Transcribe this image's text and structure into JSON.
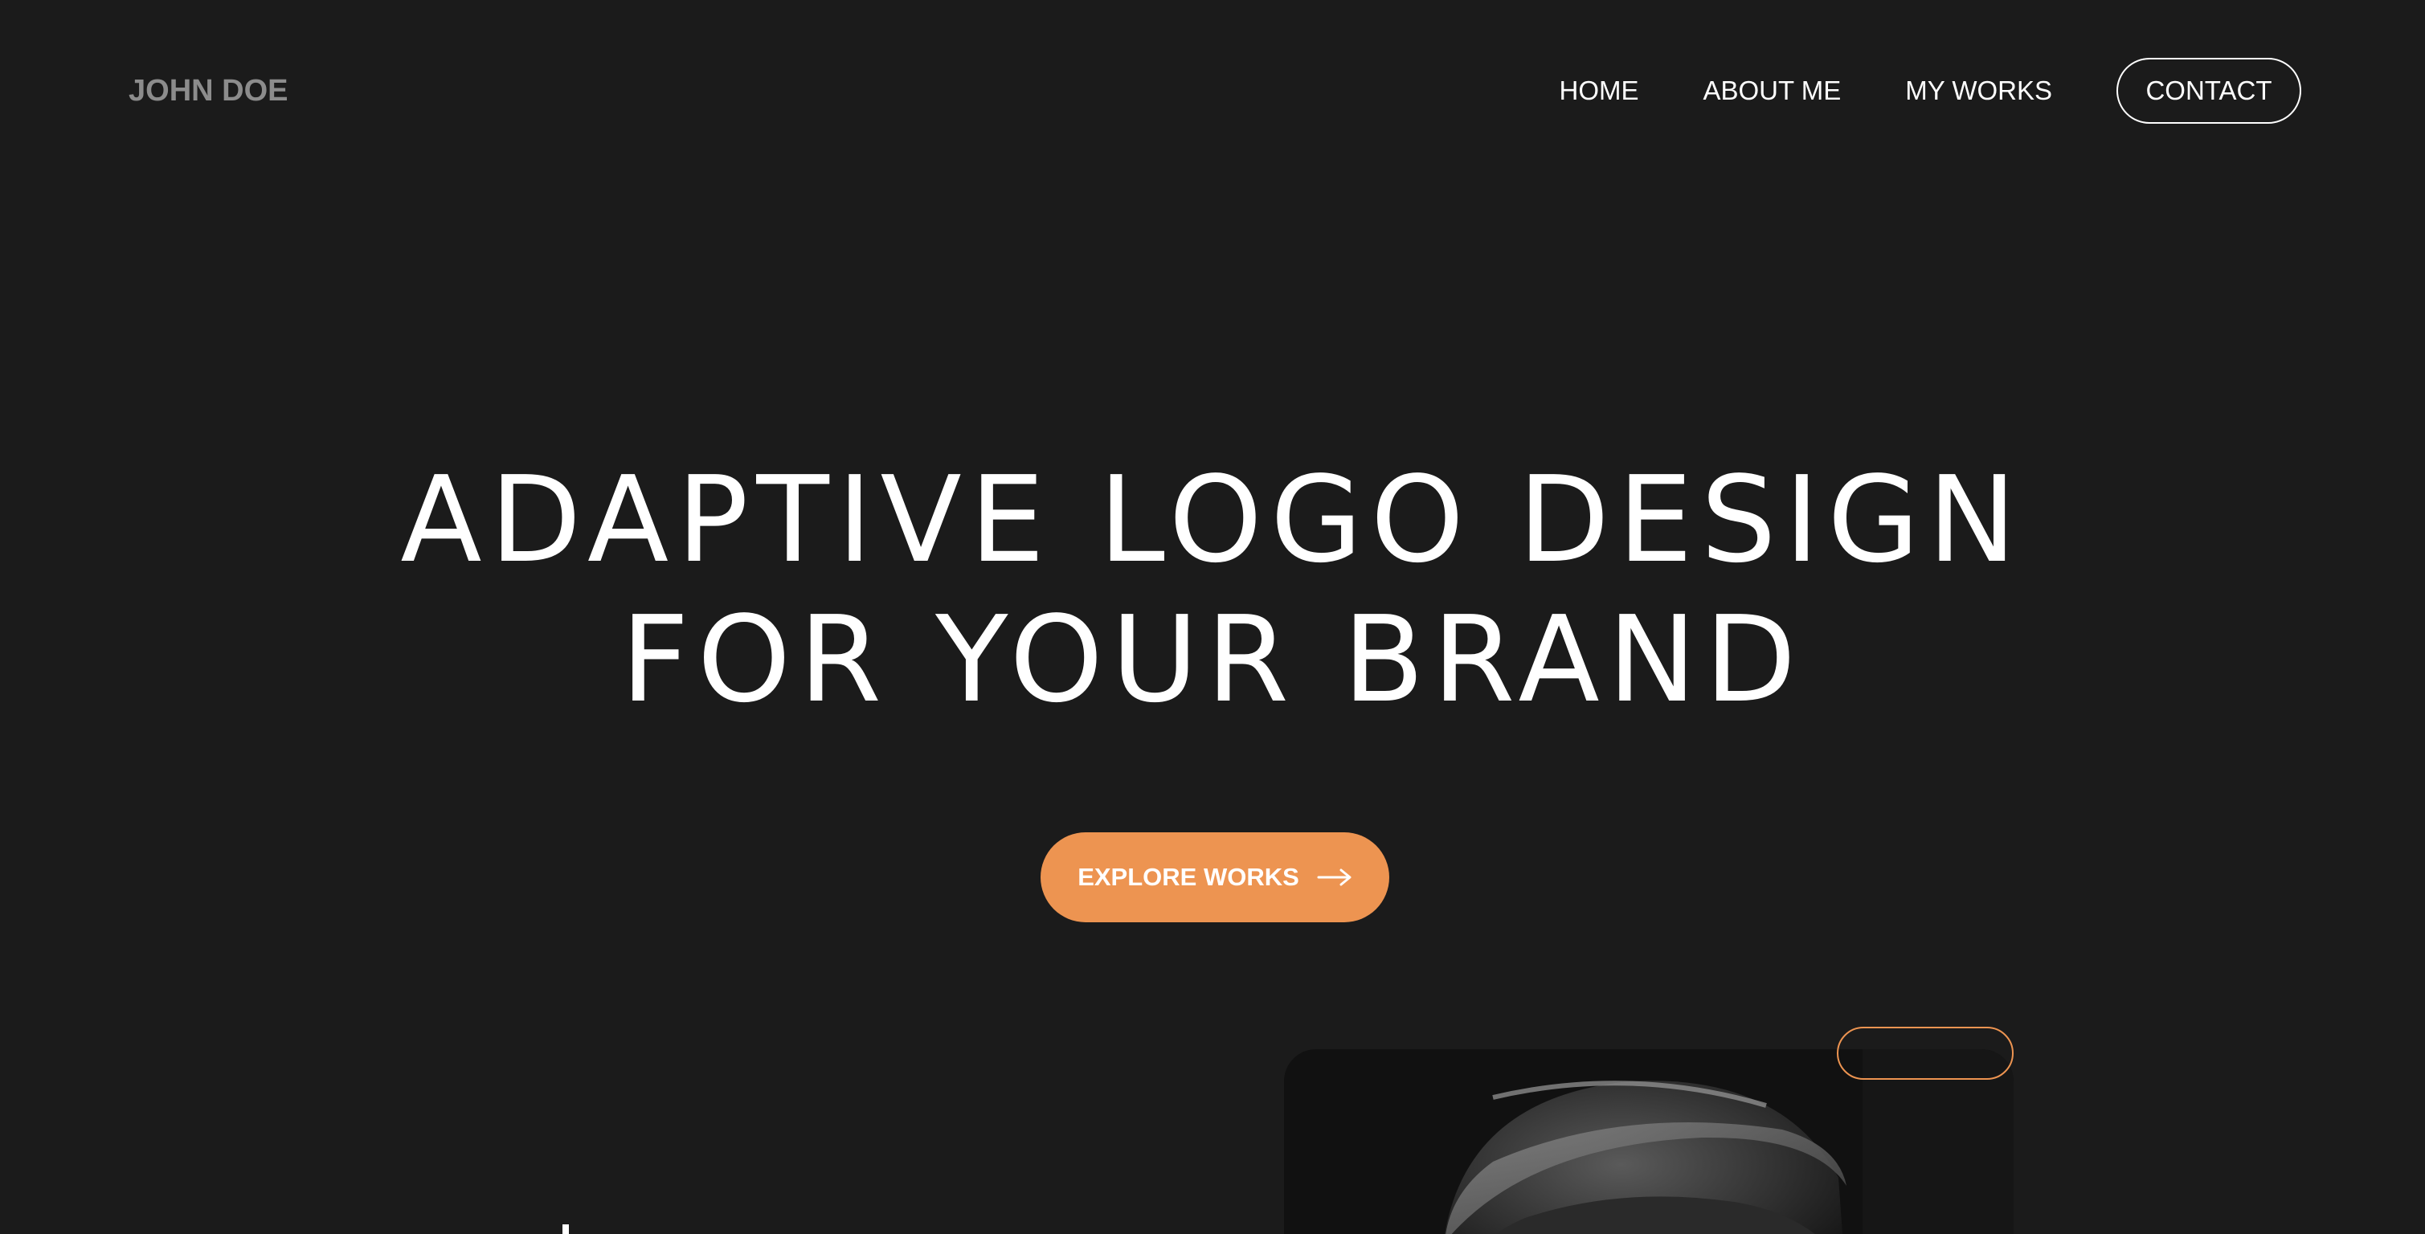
{
  "header": {
    "logo": "JOHN DOE",
    "nav": {
      "home": "HOME",
      "about": "ABOUT ME",
      "works": "MY WORKS",
      "contact": "CONTACT"
    }
  },
  "hero": {
    "title_line1": "ADAPTIVE LOGO DESIGN",
    "title_line2": "FOR YOUR BRAND",
    "cta_label": "EXPLORE WORKS",
    "cta_icon": "arrow-right-icon"
  },
  "colors": {
    "background": "#1b1b1b",
    "accent": "#ed9451",
    "logo_text": "#8c8c8c",
    "text": "#ffffff"
  }
}
